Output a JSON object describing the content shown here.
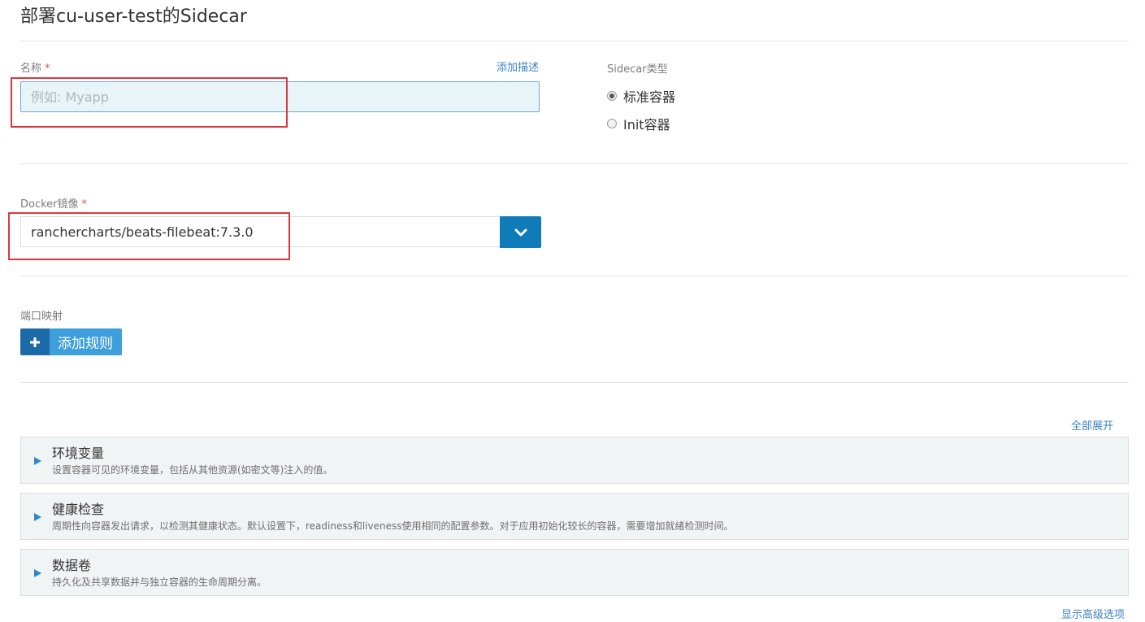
{
  "page": {
    "title": "部署cu-user-test的Sidecar"
  },
  "name_field": {
    "label": "名称",
    "required_mark": "*",
    "placeholder": "例如: Myapp",
    "value": "",
    "add_description_link": "添加描述"
  },
  "sidecar_type": {
    "label": "Sidecar类型",
    "options": [
      {
        "label": "标准容器",
        "checked": true
      },
      {
        "label": "Init容器",
        "checked": false
      }
    ]
  },
  "docker_image": {
    "label": "Docker镜像",
    "required_mark": "*",
    "value": "ranchercharts/beats-filebeat:7.3.0",
    "dropdown_icon": "chevron-down-icon"
  },
  "port_mapping": {
    "label": "端口映射",
    "add_rule_icon": "plus-icon",
    "add_rule_label": "添加规则"
  },
  "sections": {
    "expand_all_link": "全部展开",
    "items": [
      {
        "title": "环境变量",
        "description": "设置容器可见的环境变量，包括从其他资源(如密文等)注入的值。"
      },
      {
        "title": "健康检查",
        "description": "周期性向容器发出请求，以检测其健康状态。默认设置下，readiness和liveness使用相同的配置参数。对于应用初始化较长的容器，需要增加就绪检测时间。"
      },
      {
        "title": "数据卷",
        "description": "持久化及共享数据并与独立容器的生命周期分离。"
      }
    ],
    "advanced_options_link": "显示高级选项"
  },
  "colors": {
    "primary": "#0f7bb8",
    "link": "#3c82c4",
    "annotation_red": "#e0373b",
    "required_red": "#d9534f"
  }
}
